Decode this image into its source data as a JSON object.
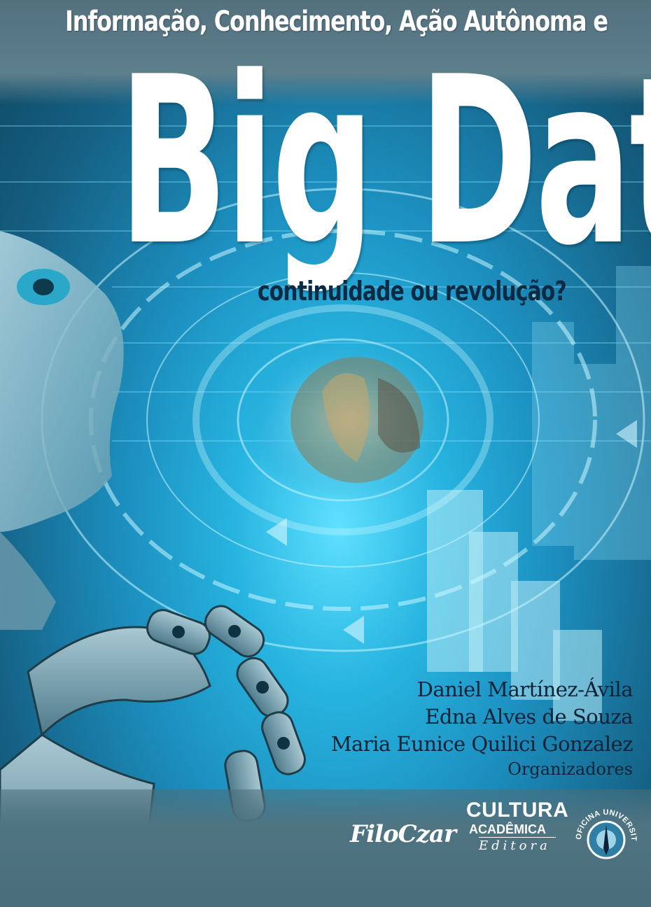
{
  "cover": {
    "series_title": "Informação, Conhecimento, Ação Autônoma e",
    "main_title": "Big Data",
    "subtitle": "continuidade ou revolução?",
    "authors": [
      "Daniel Martínez-Ávila",
      "Edna Alves de Souza",
      "Maria Eunice Quilici Gonzalez"
    ],
    "organizers_label": "Organizadores"
  },
  "publishers": {
    "filoczar": "FiloCzar",
    "cultura_line1": "CULTURA",
    "cultura_line2": "ACADÊMICA",
    "cultura_line3": "Editora",
    "oficina_seal_text": "OFICINA UNIVERSITÁRIA"
  },
  "colors": {
    "title_white": "#ffffff",
    "subtitle_navy": "#0b2a44",
    "band_gray": "#53707d",
    "cyan_glow": "#5fe0ff"
  },
  "icons": [
    "robot-figure-artwork",
    "digital-eye-artwork",
    "oficina-seal-logo"
  ]
}
